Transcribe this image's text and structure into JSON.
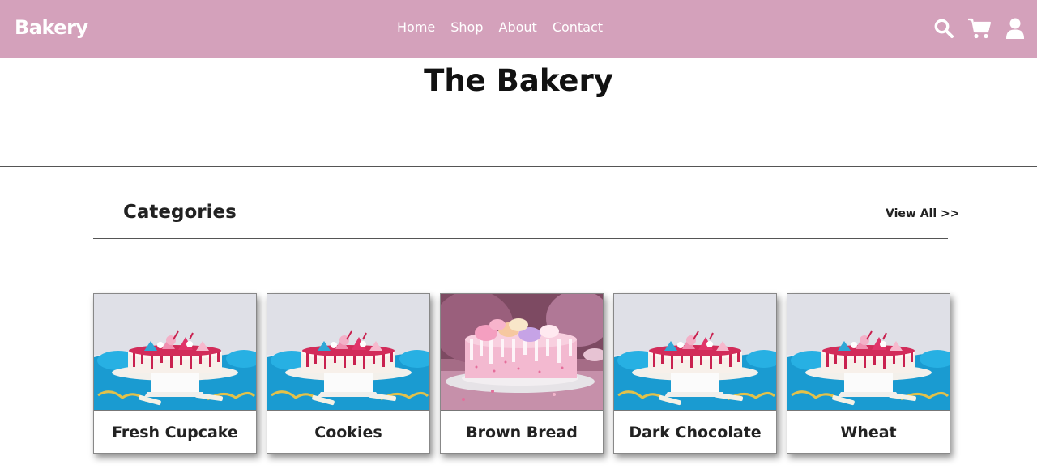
{
  "nav": {
    "brand": "Bakery",
    "links": [
      {
        "label": "Home"
      },
      {
        "label": "Shop"
      },
      {
        "label": "About"
      },
      {
        "label": "Contact"
      }
    ],
    "icons": [
      "search-icon",
      "cart-icon",
      "user-icon"
    ]
  },
  "hero": {
    "title": "The Bakery"
  },
  "categories": {
    "title": "Categories",
    "view_all": "View All >>",
    "items": [
      {
        "label": "Fresh Cupcake",
        "image": "blue-cake"
      },
      {
        "label": "Cookies",
        "image": "blue-cake"
      },
      {
        "label": "Brown Bread",
        "image": "pink-drip-cake"
      },
      {
        "label": "Dark Chocolate",
        "image": "blue-cake"
      },
      {
        "label": "Wheat",
        "image": "blue-cake"
      }
    ]
  },
  "colors": {
    "navbar": "#d4a1bb",
    "nav_text": "#ffffff",
    "title_text": "#111111"
  }
}
